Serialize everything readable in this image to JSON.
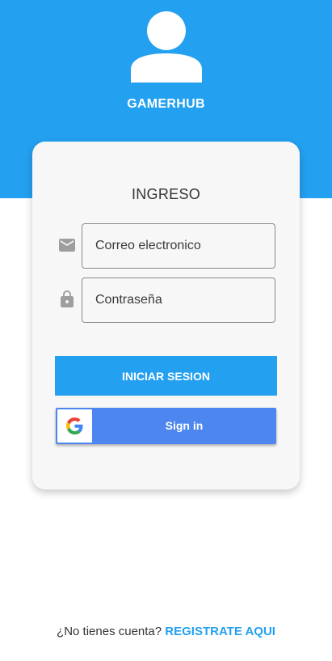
{
  "header": {
    "app_name": "GAMERHUB",
    "avatar_icon": "user-avatar-icon"
  },
  "login_card": {
    "title": "INGRESO",
    "email_field": {
      "icon": "mail-icon",
      "placeholder": "Correo electronico",
      "value": ""
    },
    "password_field": {
      "icon": "lock-icon",
      "placeholder": "Contraseña",
      "value": ""
    },
    "login_button_label": "INICIAR SESION",
    "google_button": {
      "icon": "google-icon",
      "label": "Sign in"
    }
  },
  "footer": {
    "prompt": "¿No tienes cuenta?",
    "register_link": "REGISTRATE AQUI"
  },
  "colors": {
    "primary": "#24a0f0",
    "google_blue": "#4c86ee",
    "card_bg": "#f7f7f7"
  }
}
